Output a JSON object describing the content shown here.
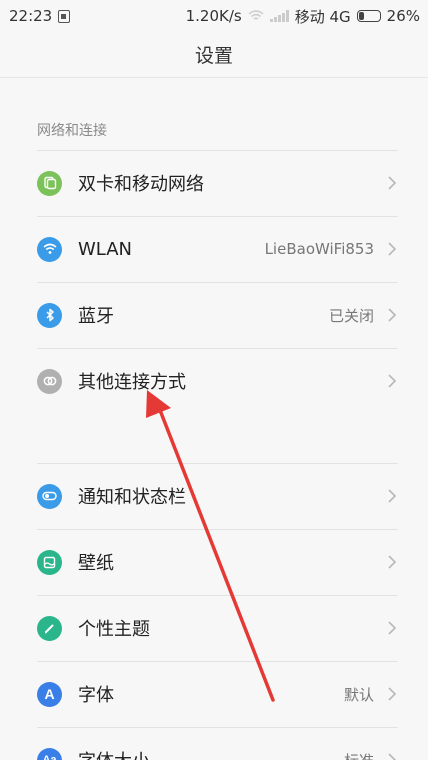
{
  "status": {
    "time": "22:23",
    "speed": "1.20K/s",
    "carrier": "移动 4G",
    "battery": "26%",
    "battery_level": 0.26
  },
  "title": "设置",
  "section_network": "网络和连接",
  "items_network": [
    {
      "label": "双卡和移动网络",
      "value": "",
      "icon": "sim-cards-icon",
      "color": "#7bc25a"
    },
    {
      "label": "WLAN",
      "value": "LieBaoWiFi853",
      "icon": "wifi-icon",
      "color": "#3a9be8"
    },
    {
      "label": "蓝牙",
      "value": "已关闭",
      "icon": "bluetooth-icon",
      "color": "#3a9be8"
    },
    {
      "label": "其他连接方式",
      "value": "",
      "icon": "link-rings-icon",
      "color": "#b0b0b0"
    }
  ],
  "items_display": [
    {
      "label": "通知和状态栏",
      "value": "",
      "icon": "toggle-icon",
      "color": "#3a9be8"
    },
    {
      "label": "壁纸",
      "value": "",
      "icon": "wallpaper-icon",
      "color": "#2bb58a"
    },
    {
      "label": "个性主题",
      "value": "",
      "icon": "brush-icon",
      "color": "#2bb58a"
    },
    {
      "label": "字体",
      "value": "默认",
      "icon": "font-a-icon",
      "color": "#3a7fe8"
    },
    {
      "label": "字体大小",
      "value": "标准",
      "icon": "font-size-icon",
      "color": "#3a7fe8"
    }
  ],
  "annotation": {
    "color": "#e53935"
  }
}
